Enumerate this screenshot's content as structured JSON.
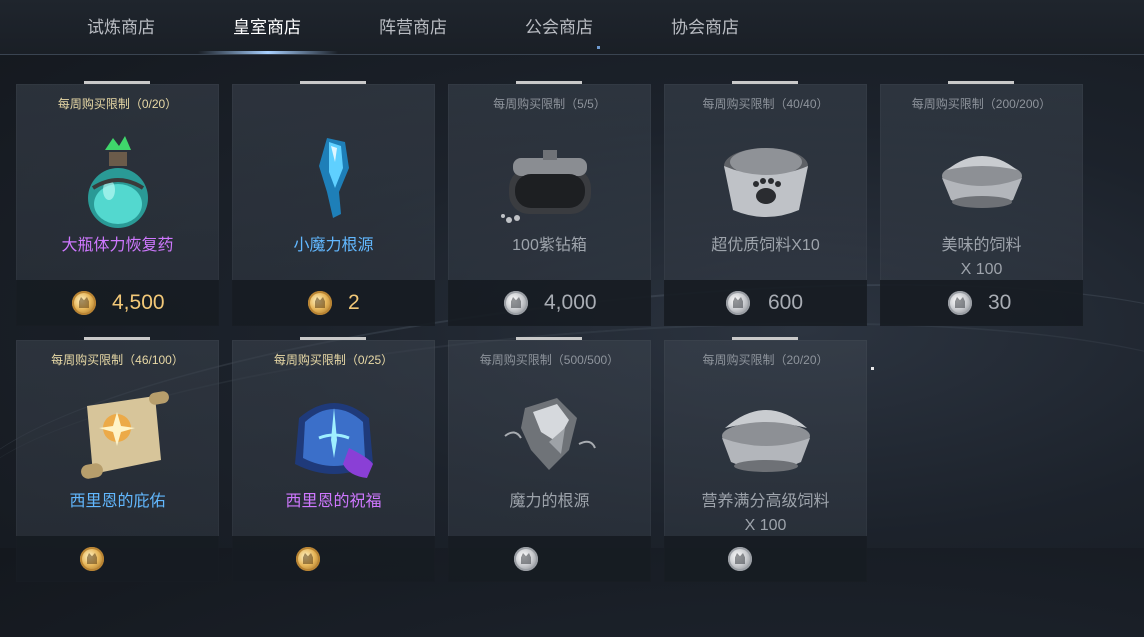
{
  "tabs": [
    {
      "label": "试炼商店",
      "active": false
    },
    {
      "label": "皇室商店",
      "active": true
    },
    {
      "label": "阵营商店",
      "active": false
    },
    {
      "label": "公会商店",
      "active": false
    },
    {
      "label": "协会商店",
      "active": false
    }
  ],
  "items": [
    {
      "limit": "每周购买限制（0/20）",
      "name": "大瓶体力恢复药",
      "name_line2": "",
      "price": "4,500",
      "currency": "gold",
      "icon": "potion-icon",
      "available": true
    },
    {
      "limit": "",
      "name": "小魔力根源",
      "name_line2": "",
      "price": "2",
      "currency": "gold",
      "icon": "blue-crystal-icon",
      "available": true
    },
    {
      "limit": "每周购买限制（5/5）",
      "name": "100紫钻箱",
      "name_line2": "",
      "price": "4,000",
      "currency": "silver",
      "icon": "chest-icon",
      "available": false
    },
    {
      "limit": "每周购买限制（40/40）",
      "name": "超优质饲料X10",
      "name_line2": "",
      "price": "600",
      "currency": "silver",
      "icon": "pet-bowl-icon",
      "available": false
    },
    {
      "limit": "每周购买限制（200/200）",
      "name": "美味的饲料",
      "name_line2": "X 100",
      "price": "30",
      "currency": "silver",
      "icon": "food-bowl-icon",
      "available": false
    },
    {
      "limit": "每周购买限制（46/100）",
      "name": "西里恩的庇佑",
      "name_line2": "",
      "price": "",
      "currency": "gold",
      "icon": "scroll-icon",
      "available": true
    },
    {
      "limit": "每周购买限制（0/25）",
      "name": "西里恩的祝福",
      "name_line2": "",
      "price": "",
      "currency": "gold",
      "icon": "rune-stone-icon",
      "available": true
    },
    {
      "limit": "每周购买限制（500/500）",
      "name": "魔力的根源",
      "name_line2": "",
      "price": "",
      "currency": "silver",
      "icon": "grey-crystal-icon",
      "available": false
    },
    {
      "limit": "每周购买限制（20/20）",
      "name": "营养满分高级饲料",
      "name_line2": "X 100",
      "price": "",
      "currency": "silver",
      "icon": "food-bowl-icon",
      "available": false
    }
  ],
  "colors": {
    "accent_tab": "#a8d0ff",
    "gold_price": "#f2c878",
    "silver_price": "#a9adb4",
    "name_purple": "#cf78ff",
    "name_blue": "#62b8ff",
    "limit_gold": "#e8d9a6"
  }
}
